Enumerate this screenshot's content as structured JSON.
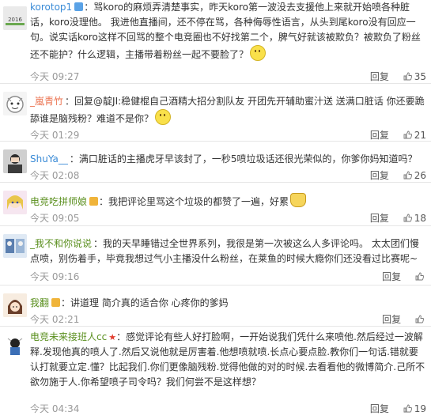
{
  "ui": {
    "reply_label": "回复"
  },
  "comments": [
    {
      "username": "korotop1",
      "badge": "blue",
      "text": "骂koro的麻烦弄清楚事实，昨天koro第一波没去支援他上来就开始喷各种脏话，koro没理他。 我进他直播间，还不停在骂，各种侮辱性语言，从头到尾koro没有回应一句。说实话koro这样不回骂的整个电竞圈也不好找第二个，脾气好就该被欺负？被欺负了粉丝还不能护？什么逻辑，主播带着粉丝一起不要脸了？",
      "emoji": "smile",
      "time": "今天 09:27",
      "likes": "35"
    },
    {
      "username": "_嵐青竹",
      "badge": "",
      "text": "回复@靛JI:稳健棍自己酒精大招分割队友 开团先开辅助蜜汁送 送满口脏话 你还要跪舔谁是脑残粉？难道不是你？",
      "emoji": "smile",
      "time": "今天 01:29",
      "likes": "21"
    },
    {
      "username": "ShuYa__",
      "badge": "",
      "text": "满口脏话的主播虎牙早该封了，一秒5喷垃圾话还很光荣似的，你爹你妈知道吗？",
      "emoji": "",
      "time": "今天 02:08",
      "likes": "26"
    },
    {
      "username": "电竞吃拼师娘",
      "badge": "gold",
      "text": "我把评论里骂这个垃圾的都赞了一遍，好累",
      "emoji": "cat",
      "time": "今天 09:05",
      "likes": "18"
    },
    {
      "username": "_我不和你说说",
      "badge": "",
      "text": "我的天早睡错过全世界系列，我很是第一次被这么人多评论吗。 太太团们慢点喷，别伤着手，毕竟我想过气小主播没什么粉丝，在莱鱼的时候大瘾你们还没看过比赛呢~",
      "emoji": "",
      "time": "今天 09:16",
      "likes": ""
    },
    {
      "username": "我翻",
      "badge": "gold",
      "text": "讲道理 简介真的适合你 心疼你的爹妈",
      "emoji": "",
      "time": "今天 02:21",
      "likes": ""
    },
    {
      "username": "电竞未来接班人cc",
      "badge": "star",
      "text": "感觉评论有些人好打脸啊，一开始说我们凭什么来喷他.然后经过一波解释.发现他真的喷人了.然后又说他就是厉害着.他想喷就喷.长点心要点脸.教你们一句话.错就要认打就要立定.懂？比起我们.你们更像脑残粉.觉得他做的对的时候.去看看他的微博简介.己所不欲勿施于人.你希望喷子司令吗？我们何尝不是这样想？",
      "emoji": "",
      "time": "今天 04:34",
      "likes": "19"
    }
  ]
}
